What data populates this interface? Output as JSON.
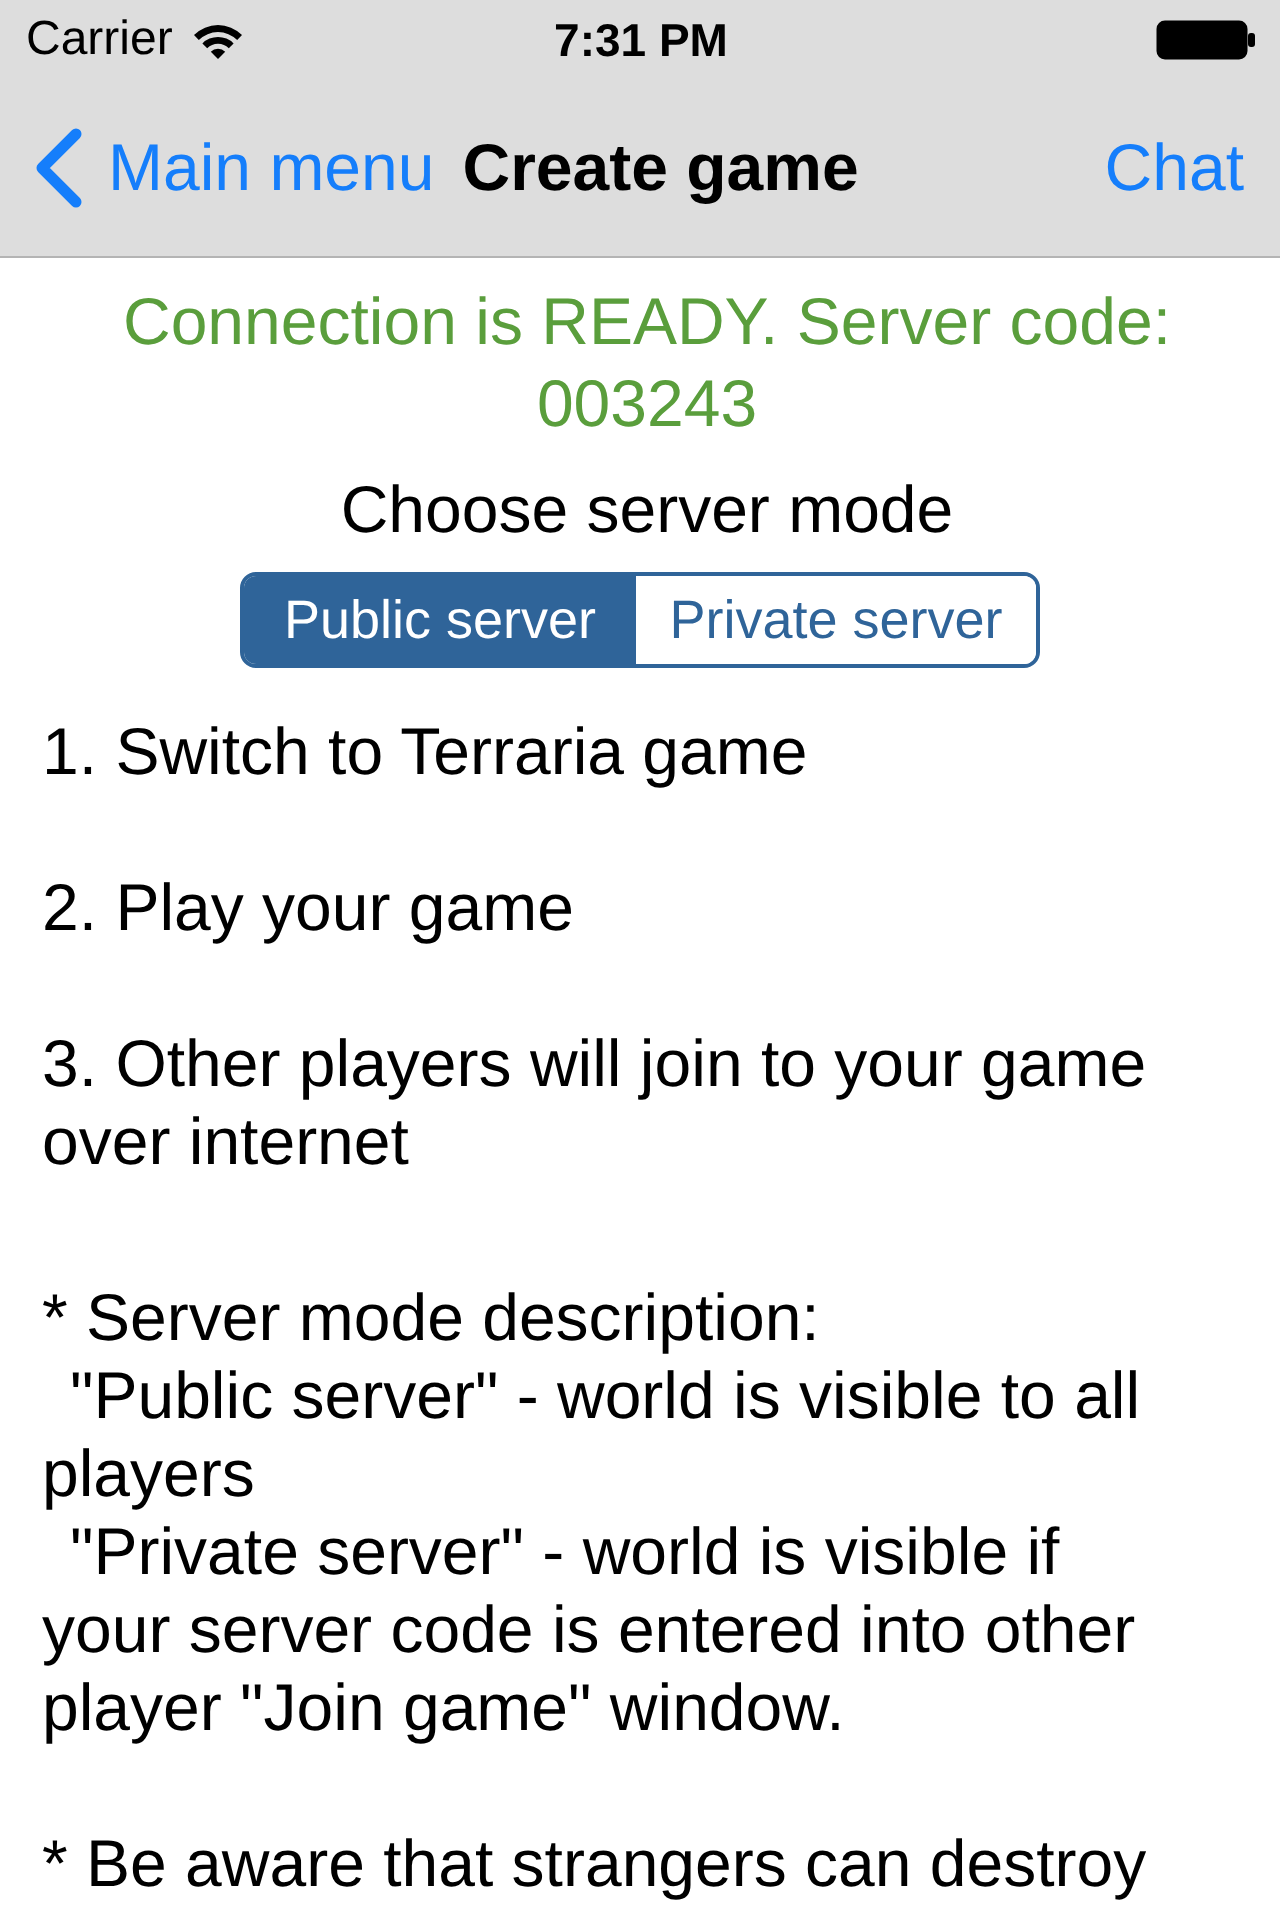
{
  "status_bar": {
    "carrier": "Carrier",
    "time": "7:31 PM"
  },
  "nav_bar": {
    "back": "Main menu",
    "title": "Create game",
    "action": "Chat"
  },
  "connection_status": {
    "lines": [
      "Connection is READY. Server code:",
      "003243"
    ]
  },
  "mode_prompt": "Choose server mode",
  "server_modes": [
    {
      "label": "Public server",
      "selected": true
    },
    {
      "label": "Private server",
      "selected": false
    }
  ],
  "steps": [
    "1. Switch to Terraria game",
    "2. Play your game",
    "3. Other players will join to your game over internet"
  ],
  "mode_description": {
    "heading": "* Server mode description:",
    "items": [
      "\"Public server\" - world is visible to all players",
      "\"Private server\" - world is visible if your server code is entered into other player \"Join game\" window."
    ]
  },
  "warning": "* Be aware that strangers can destroy"
}
